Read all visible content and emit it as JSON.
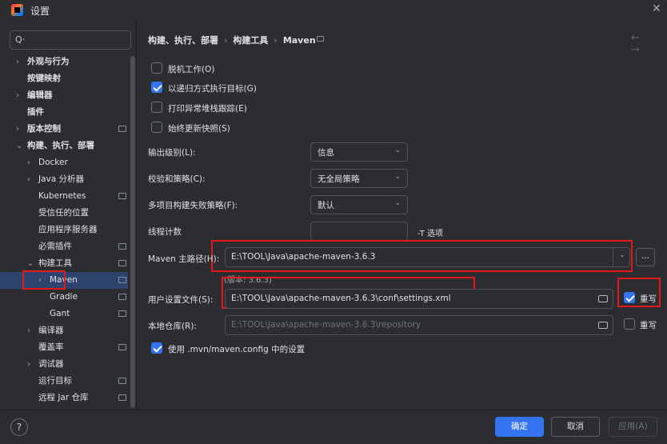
{
  "window": {
    "title": "设置"
  },
  "sidebar": {
    "search_placeholder": "",
    "items": [
      {
        "label": "外观与行为",
        "chevron": "›",
        "bold": true
      },
      {
        "label": "按键映射",
        "chevron": "",
        "bold": true
      },
      {
        "label": "编辑器",
        "chevron": "›",
        "bold": true
      },
      {
        "label": "插件",
        "chevron": "",
        "bold": true
      },
      {
        "label": "版本控制",
        "chevron": "›",
        "bold": true
      },
      {
        "label": "构建、执行、部署",
        "chevron": "⌄",
        "bold": true
      },
      {
        "label": "Docker",
        "chevron": "›"
      },
      {
        "label": "Java 分析器",
        "chevron": "›"
      },
      {
        "label": "Kubernetes",
        "chevron": ""
      },
      {
        "label": "受信任的位置",
        "chevron": ""
      },
      {
        "label": "应用程序服务器",
        "chevron": ""
      },
      {
        "label": "必需插件",
        "chevron": ""
      },
      {
        "label": "构建工具",
        "chevron": "⌄"
      },
      {
        "label": "Maven",
        "chevron": "›",
        "selected": true
      },
      {
        "label": "Gradle",
        "chevron": ""
      },
      {
        "label": "Gant",
        "chevron": ""
      },
      {
        "label": "编译器",
        "chevron": "›"
      },
      {
        "label": "覆盖率",
        "chevron": ""
      },
      {
        "label": "调试器",
        "chevron": "›"
      },
      {
        "label": "运行目标",
        "chevron": ""
      },
      {
        "label": "远程 Jar 仓库",
        "chevron": ""
      }
    ]
  },
  "breadcrumb": [
    "构建、执行、部署",
    "构建工具",
    "Maven"
  ],
  "breadcrumb_sep": "›",
  "nav_arrows": "← →",
  "checkboxes": [
    {
      "label": "脱机工作(O)",
      "checked": false
    },
    {
      "label": "以递归方式执行目标(G)",
      "checked": true
    },
    {
      "label": "打印异常堆栈跟踪(E)",
      "checked": false
    },
    {
      "label": "始终更新快照(S)",
      "checked": false
    }
  ],
  "settings": {
    "output_level_label": "输出级别(L):",
    "output_level_value": "信息",
    "checksum_label": "校验和策略(C):",
    "checksum_value": "无全局策略",
    "failure_label": "多项目构建失败策略(F):",
    "failure_value": "默认",
    "threads_label": "线程计数",
    "threads_value": "",
    "threads_hint": "-T 选项",
    "maven_home_label": "Maven 主路径(H):",
    "maven_home_value": "E:\\TOOL\\Java\\apache-maven-3.6.3",
    "maven_version": "(版本: 3.6.3)",
    "browse_label": "...",
    "user_settings_label": "用户设置文件(S):",
    "user_settings_value": "E:\\TOOL\\Java\\apache-maven-3.6.3\\conf\\settings.xml",
    "override_label": "重写",
    "override_checked": true,
    "local_repo_label": "本地仓库(R):",
    "local_repo_value": "E:\\TOOL\\Java\\apache-maven-3.6.3\\repository",
    "local_override_label": "重写",
    "local_override_checked": false,
    "use_config_label": "使用 .mvn/maven.config 中的设置",
    "use_config_checked": true
  },
  "footer": {
    "help": "?",
    "ok": "确定",
    "cancel": "取消",
    "apply": "应用(A)"
  },
  "colors": {
    "accent": "#3574f0",
    "highlight_box": "#e0191d",
    "selection": "#2e436e"
  }
}
